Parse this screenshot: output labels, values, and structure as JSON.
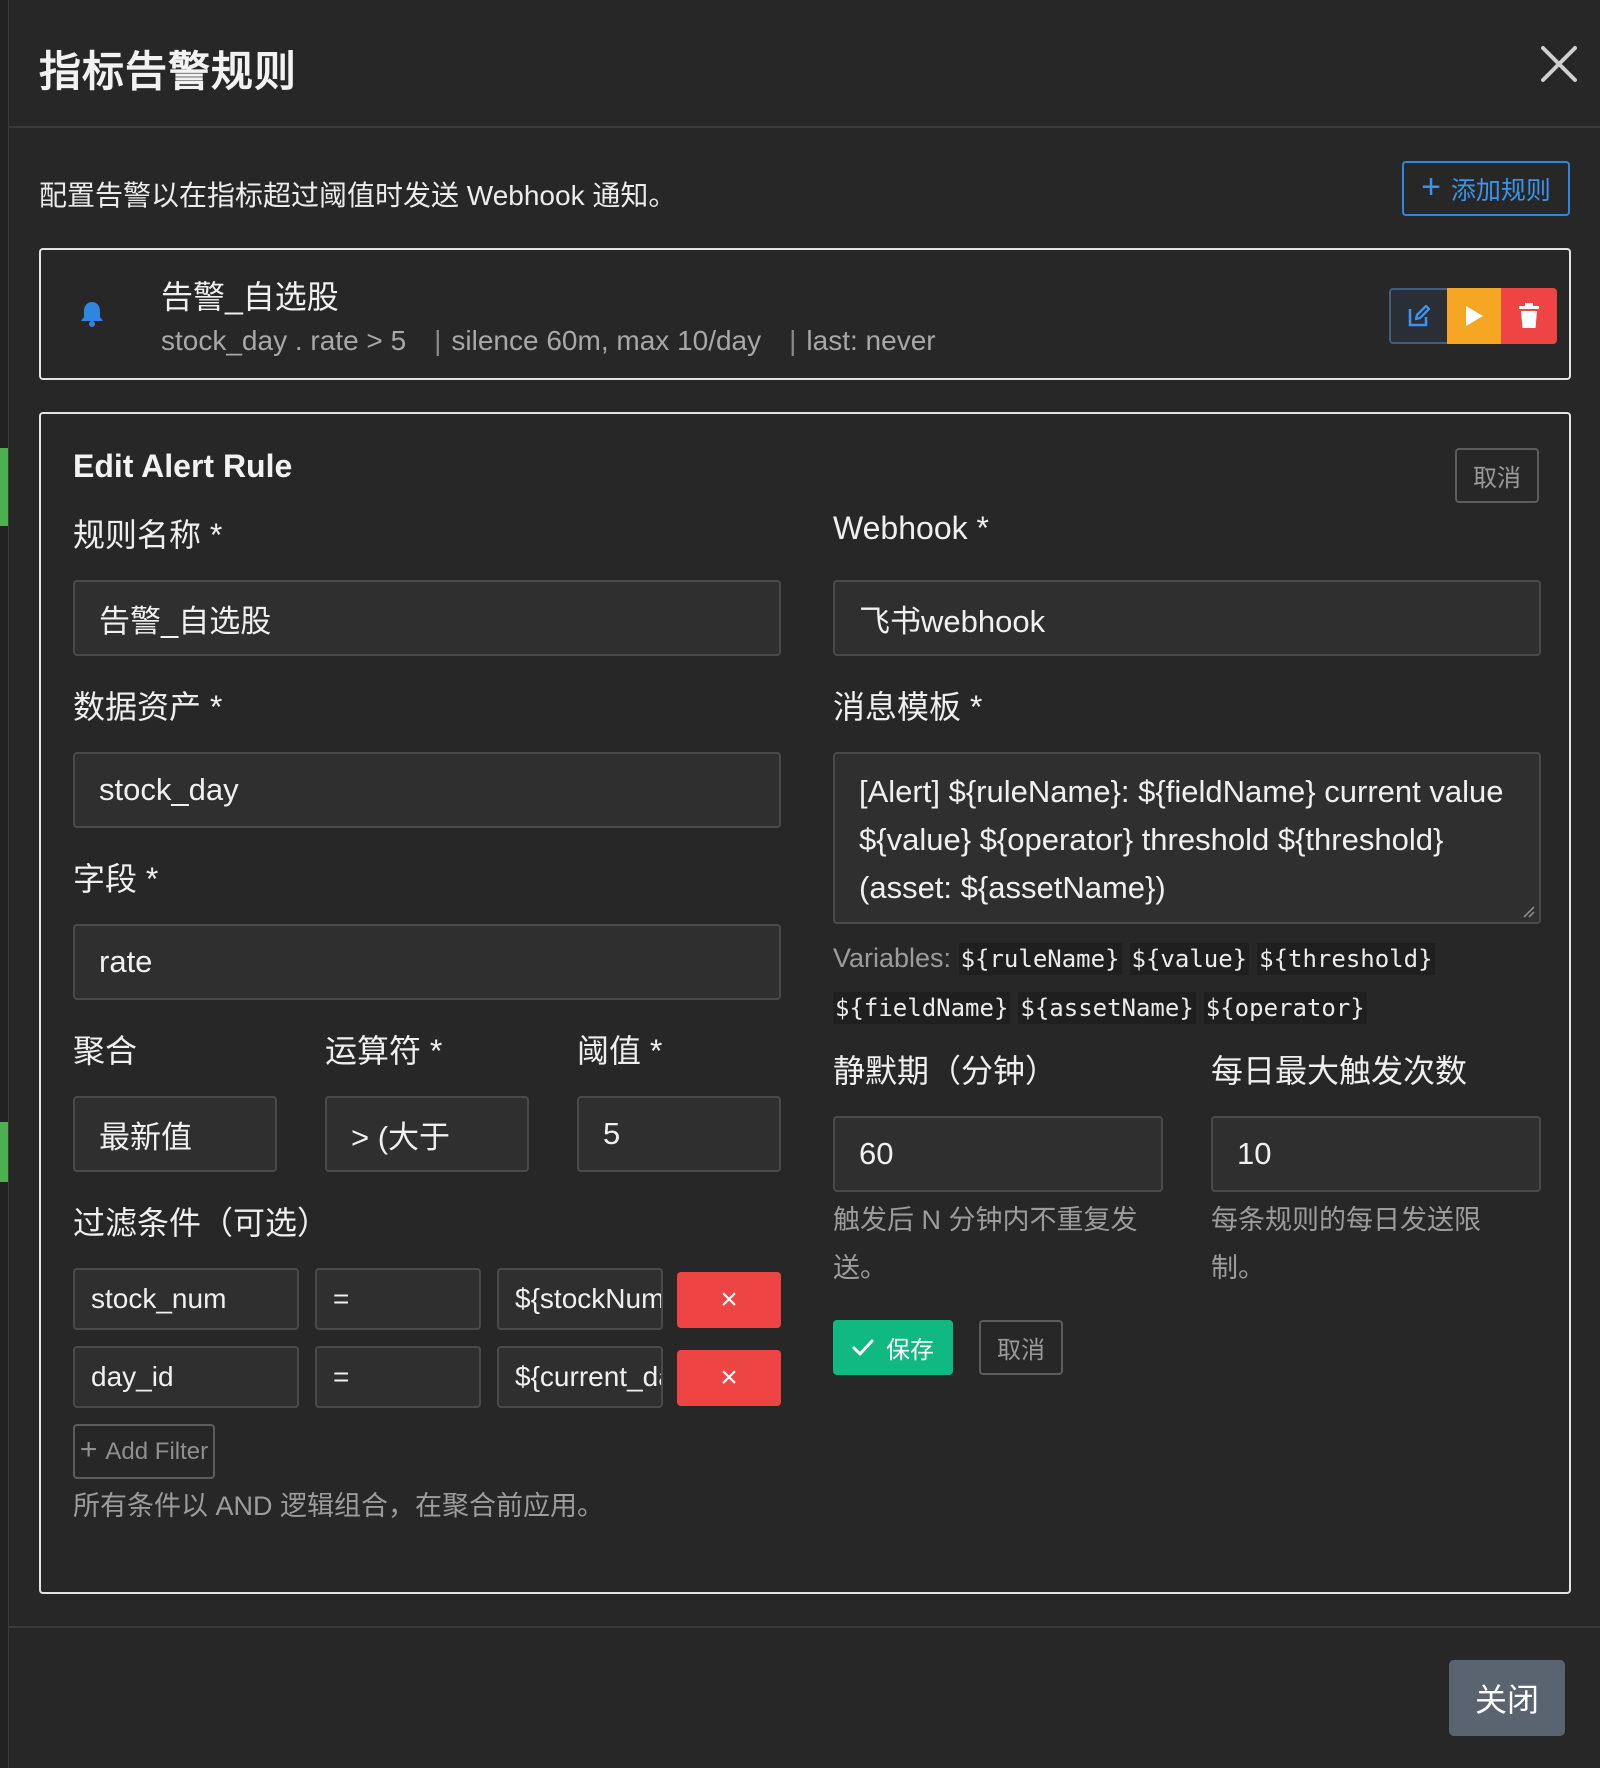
{
  "modal": {
    "title": "指标告警规则",
    "description": "配置告警以在指标超过阈值时发送 Webhook 通知。",
    "add_rule_label": "添加规则",
    "close_label": "关闭"
  },
  "rule": {
    "name": "告警_自选股",
    "condition": "stock_day . rate > 5",
    "silence": "silence 60m, max 10/day",
    "last": "last: never"
  },
  "editor": {
    "title": "Edit Alert Rule",
    "cancel_label": "取消",
    "rule_name_label": "规则名称 *",
    "rule_name_value": "告警_自选股",
    "webhook_label": "Webhook *",
    "webhook_value": "飞书webhook",
    "asset_label": "数据资产 *",
    "asset_value": "stock_day",
    "template_label": "消息模板 *",
    "template_value": "[Alert] ${ruleName}: ${fieldName} current value ${value} ${operator} threshold ${threshold} (asset: ${assetName})",
    "variables_label": "Variables:",
    "variables": [
      "${ruleName}",
      "${value}",
      "${threshold}",
      "${fieldName}",
      "${assetName}",
      "${operator}"
    ],
    "field_label": "字段 *",
    "field_value": "rate",
    "agg_label": "聚合",
    "agg_value": "最新值",
    "op_label": "运算符 *",
    "op_value": "> (大于",
    "threshold_label": "阈值 *",
    "threshold_value": "5",
    "silence_label": "静默期（分钟）",
    "silence_value": "60",
    "silence_help": "触发后 N 分钟内不重复发送。",
    "max_label": "每日最大触发次数",
    "max_value": "10",
    "max_help": "每条规则的每日发送限制。",
    "filters_label": "过滤条件（可选）",
    "filters": [
      {
        "field": "stock_num",
        "op": "=",
        "value": "${stockNum}"
      },
      {
        "field": "day_id",
        "op": "=",
        "value": "${current_day}"
      }
    ],
    "filter_delete_label": "×",
    "add_filter_label": "Add Filter",
    "filters_help": "所有条件以 AND 逻辑组合，在聚合前应用。",
    "save_label": "保存",
    "cancel2_label": "取消"
  },
  "colors": {
    "primary": "#2f86e0",
    "success": "#10b981",
    "warning": "#f5a623",
    "danger": "#ef4444",
    "secondary": "#5a6370"
  }
}
